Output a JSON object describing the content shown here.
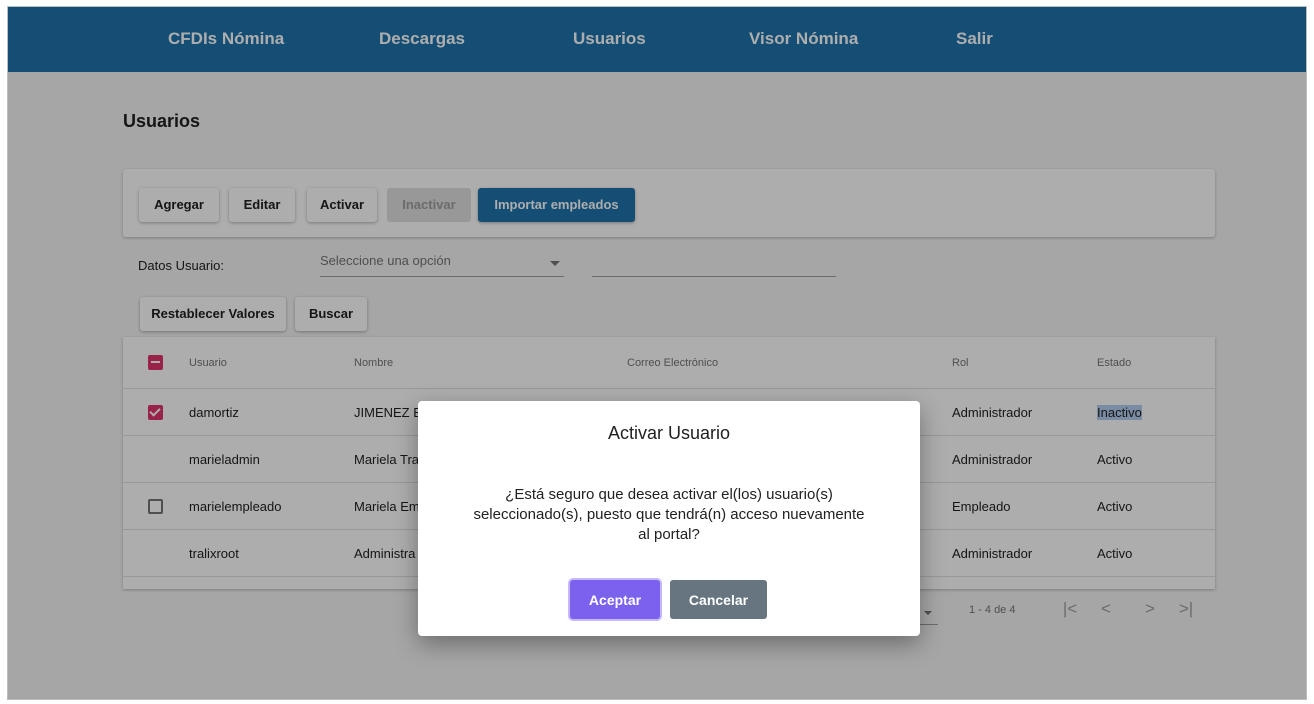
{
  "nav": {
    "items": [
      "CFDIs Nómina",
      "Descargas",
      "Usuarios",
      "Visor Nómina",
      "Salir"
    ]
  },
  "page": {
    "title": "Usuarios"
  },
  "toolbar": {
    "add": "Agregar",
    "edit": "Editar",
    "activate": "Activar",
    "deactivate": "Inactivar",
    "import": "Importar empleados"
  },
  "filter": {
    "label": "Datos Usuario:",
    "select_placeholder": "Seleccione una opción",
    "text_value": "",
    "reset": "Restablecer Valores",
    "search": "Buscar"
  },
  "table": {
    "headers": {
      "usuario": "Usuario",
      "nombre": "Nombre",
      "correo": "Correo Electrónico",
      "rol": "Rol",
      "estado": "Estado"
    },
    "rows": [
      {
        "usuario": "damortiz",
        "nombre": "JIMENEZ E",
        "correo": "",
        "rol": "Administrador",
        "estado": "Inactivo",
        "checkbox": "checked"
      },
      {
        "usuario": "marieladmin",
        "nombre": "Mariela Tra",
        "correo": "",
        "rol": "Administrador",
        "estado": "Activo",
        "checkbox": "none"
      },
      {
        "usuario": "marielempleado",
        "nombre": "Mariela Em",
        "correo": "",
        "rol": "Empleado",
        "estado": "Activo",
        "checkbox": "empty"
      },
      {
        "usuario": "tralixroot",
        "nombre": "Administra",
        "correo": "",
        "rol": "Administrador",
        "estado": "Activo",
        "checkbox": "none"
      }
    ]
  },
  "paginator": {
    "range": "1 - 4 de 4",
    "first": "|<",
    "prev": "<",
    "next": ">",
    "last": ">|"
  },
  "dialog": {
    "title": "Activar Usuario",
    "message": "¿Está seguro que desea activar el(los) usuario(s) seleccionado(s), puesto que tendrá(n) acceso nuevamente al portal?",
    "accept": "Aceptar",
    "cancel": "Cancelar"
  },
  "colors": {
    "nav_bg": "#1e73ad",
    "primary": "#1e73ad",
    "checkbox_accent": "#e0336b",
    "accept_button": "#7b61ee",
    "cancel_button": "#667580"
  }
}
